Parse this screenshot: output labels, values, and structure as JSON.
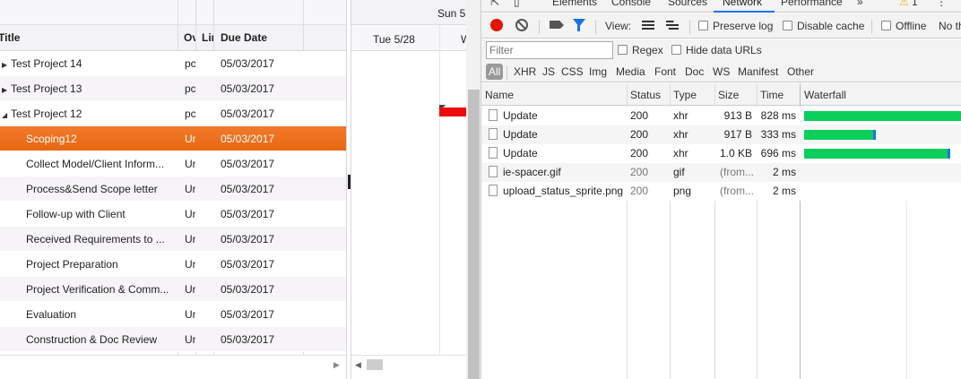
{
  "gantt": {
    "timeline_top_label": "Sun 5",
    "columns": {
      "title": "Title",
      "owner": "Ov",
      "link": "Lir",
      "due_date": "Due Date"
    },
    "timeline_days": [
      "Tue 5/28",
      "W"
    ],
    "rows": [
      {
        "title": "Test Project 14",
        "owner": "pc",
        "due": "05/03/2017",
        "level": 0,
        "expander": "▶"
      },
      {
        "title": "Test Project 13",
        "owner": "pc",
        "due": "05/03/2017",
        "level": 0,
        "expander": "▶"
      },
      {
        "title": "Test Project 12",
        "owner": "pc",
        "due": "05/03/2017",
        "level": 0,
        "expander": "◢"
      },
      {
        "title": "Scoping12",
        "owner": "Ur",
        "due": "05/03/2017",
        "level": 1,
        "selected": true
      },
      {
        "title": "Collect Model/Client Inform...",
        "owner": "Ur",
        "due": "05/03/2017",
        "level": 1
      },
      {
        "title": "Process&Send Scope letter",
        "owner": "Ur",
        "due": "05/03/2017",
        "level": 1
      },
      {
        "title": "Follow-up with Client",
        "owner": "Ur",
        "due": "05/03/2017",
        "level": 1
      },
      {
        "title": "Received Requirements to ...",
        "owner": "Ur",
        "due": "05/03/2017",
        "level": 1
      },
      {
        "title": "Project Preparation",
        "owner": "Ur",
        "due": "05/03/2017",
        "level": 1
      },
      {
        "title": "Project Verification & Comm...",
        "owner": "Ur",
        "due": "05/03/2017",
        "level": 1
      },
      {
        "title": "Evaluation",
        "owner": "Ur",
        "due": "05/03/2017",
        "level": 1
      },
      {
        "title": "Construction & Doc Review",
        "owner": "Ur",
        "due": "05/03/2017",
        "level": 1
      }
    ],
    "colors": {
      "selected": "#f27a2a",
      "task_bar": "#ee0b10"
    }
  },
  "devtools": {
    "tabs": [
      "Elements",
      "Console",
      "Sources",
      "Network",
      "Performance",
      "»"
    ],
    "active_tab": "Network",
    "warning_count": "1",
    "toolbar": {
      "view_label": "View:",
      "preserve_log": "Preserve log",
      "disable_cache": "Disable cache",
      "offline": "Offline",
      "throttle": "No th"
    },
    "filter": {
      "placeholder": "Filter",
      "regex": "Regex",
      "hide_data_urls": "Hide data URLs"
    },
    "types": [
      "All",
      "XHR",
      "JS",
      "CSS",
      "Img",
      "Media",
      "Font",
      "Doc",
      "WS",
      "Manifest",
      "Other"
    ],
    "columns": [
      "Name",
      "Status",
      "Type",
      "Size",
      "Time",
      "Waterfall"
    ],
    "requests": [
      {
        "name": "Update",
        "status": "200",
        "type": "xhr",
        "size": "913 B",
        "time": "828 ms",
        "waterfall_start": 0.0,
        "waterfall_length": 1.0
      },
      {
        "name": "Update",
        "status": "200",
        "type": "xhr",
        "size": "917 B",
        "time": "333 ms",
        "waterfall_start": 0.0,
        "waterfall_length": 0.44
      },
      {
        "name": "Update",
        "status": "200",
        "type": "xhr",
        "size": "1.0 KB",
        "time": "696 ms",
        "waterfall_start": 0.0,
        "waterfall_length": 0.91
      },
      {
        "name": "ie-spacer.gif",
        "status": "200",
        "type": "gif",
        "size": "(from...",
        "time": "2 ms",
        "cached": true
      },
      {
        "name": "upload_status_sprite.png",
        "status": "200",
        "type": "png",
        "size": "(from...",
        "time": "2 ms",
        "cached": true
      }
    ],
    "colors": {
      "record": "#e51400",
      "waterfall_green": "#0cce5b",
      "accent": "#1a73e8"
    }
  }
}
